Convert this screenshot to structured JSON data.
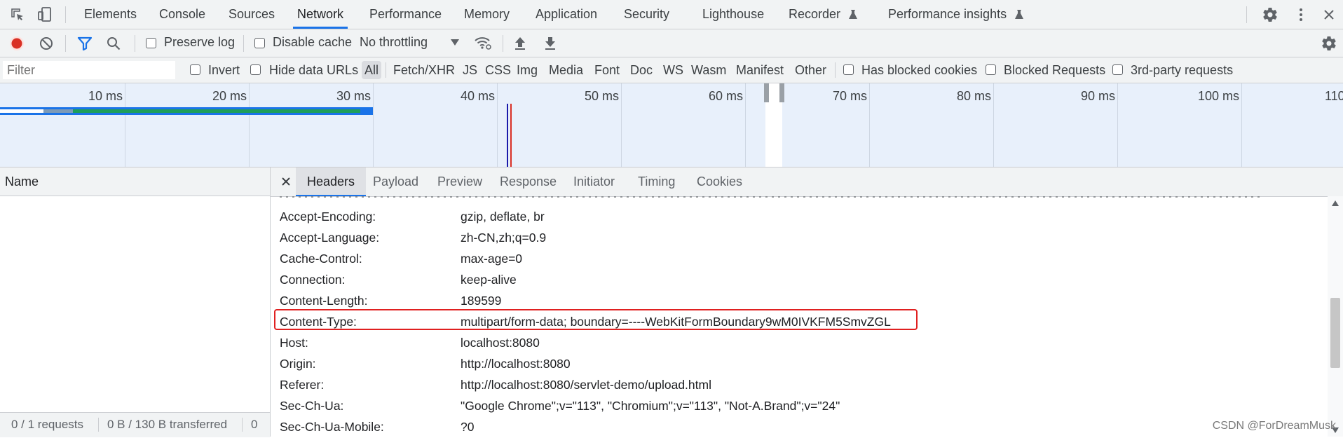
{
  "main_tabs": [
    "Elements",
    "Console",
    "Sources",
    "Network",
    "Performance",
    "Memory",
    "Application",
    "Security",
    "Lighthouse",
    "Recorder",
    "Performance insights"
  ],
  "active_main_tab": "Network",
  "toolbar": {
    "preserve_log": "Preserve log",
    "disable_cache": "Disable cache",
    "throttling": "No throttling"
  },
  "filter_bar": {
    "placeholder": "Filter",
    "invert": "Invert",
    "hide_data_urls": "Hide data URLs",
    "types": [
      "All",
      "Fetch/XHR",
      "JS",
      "CSS",
      "Img",
      "Media",
      "Font",
      "Doc",
      "WS",
      "Wasm",
      "Manifest",
      "Other"
    ],
    "selected_type": "All",
    "has_blocked_cookies": "Has blocked cookies",
    "blocked_requests": "Blocked Requests",
    "third_party": "3rd-party requests"
  },
  "overview": {
    "ticks": [
      "10 ms",
      "20 ms",
      "30 ms",
      "40 ms",
      "50 ms",
      "60 ms",
      "70 ms",
      "80 ms",
      "90 ms",
      "100 ms",
      "110"
    ]
  },
  "request_list": {
    "column_name": "Name",
    "status_requests": "0 / 1 requests",
    "status_transferred": "0 B / 130 B transferred",
    "status_extra": "0"
  },
  "detail_tabs": [
    "Headers",
    "Payload",
    "Preview",
    "Response",
    "Initiator",
    "Timing",
    "Cookies"
  ],
  "active_detail_tab": "Headers",
  "request_headers": [
    {
      "name": "Accept-Encoding:",
      "value": "gzip, deflate, br"
    },
    {
      "name": "Accept-Language:",
      "value": "zh-CN,zh;q=0.9"
    },
    {
      "name": "Cache-Control:",
      "value": "max-age=0"
    },
    {
      "name": "Connection:",
      "value": "keep-alive"
    },
    {
      "name": "Content-Length:",
      "value": "189599"
    },
    {
      "name": "Content-Type:",
      "value": "multipart/form-data; boundary=----WebKitFormBoundary9wM0IVKFM5SmvZGL"
    },
    {
      "name": "Host:",
      "value": "localhost:8080"
    },
    {
      "name": "Origin:",
      "value": "http://localhost:8080"
    },
    {
      "name": "Referer:",
      "value": "http://localhost:8080/servlet-demo/upload.html"
    },
    {
      "name": "Sec-Ch-Ua:",
      "value": "\"Google Chrome\";v=\"113\", \"Chromium\";v=\"113\", \"Not-A.Brand\";v=\"24\""
    },
    {
      "name": "Sec-Ch-Ua-Mobile:",
      "value": "?0"
    }
  ],
  "highlighted_header": "Content-Type:",
  "watermark": "CSDN @ForDreamMusk",
  "colors": {
    "accent": "#1a73e8",
    "record": "#d93025",
    "highlight": "#e02020"
  }
}
